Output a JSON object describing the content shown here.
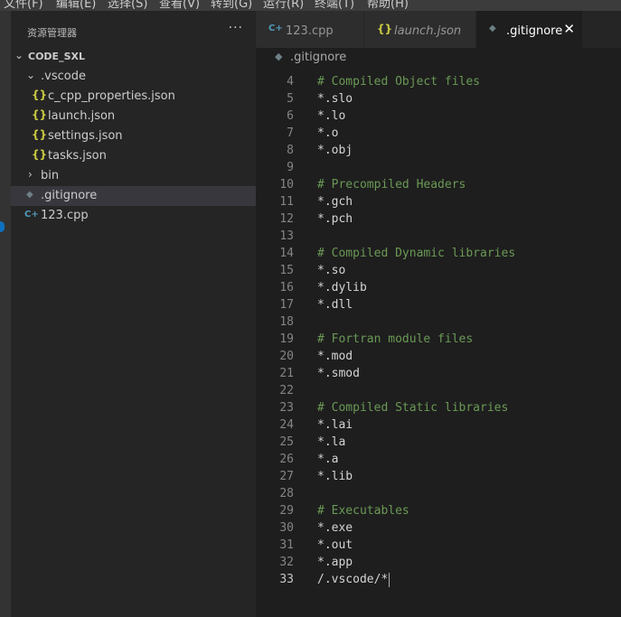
{
  "menu": [
    "文件(F)",
    "编辑(E)",
    "选择(S)",
    "查看(V)",
    "转到(G)",
    "运行(R)",
    "终端(T)",
    "帮助(H)"
  ],
  "sidebar": {
    "title": "资源管理器",
    "more": "···",
    "tree": [
      {
        "label": "CODE_SXL",
        "kind": "folder-root",
        "expanded": true
      },
      {
        "label": ".vscode",
        "kind": "folder",
        "expanded": true
      },
      {
        "label": "c_cpp_properties.json",
        "kind": "json"
      },
      {
        "label": "launch.json",
        "kind": "json"
      },
      {
        "label": "settings.json",
        "kind": "json"
      },
      {
        "label": "tasks.json",
        "kind": "json"
      },
      {
        "label": "bin",
        "kind": "folder",
        "expanded": false
      },
      {
        "label": ".gitignore",
        "kind": "git",
        "selected": true
      },
      {
        "label": "123.cpp",
        "kind": "cpp"
      }
    ]
  },
  "tabs": [
    {
      "label": "123.cpp",
      "icon": "cpp-icon",
      "active": false
    },
    {
      "label": "launch.json",
      "icon": "json-icon",
      "active": false,
      "italic": true
    },
    {
      "label": ".gitignore",
      "icon": "gitignore-icon",
      "active": true
    }
  ],
  "tab_close": "✕",
  "breadcrumb": ".gitignore",
  "icons": {
    "json": "{}",
    "cpp": "C+",
    "git": "◆"
  },
  "colors": {
    "json": "#cbcb41",
    "cpp": "#519aba",
    "git": "#6d8086",
    "comment": "#6a9955",
    "accent": "#0e70c0"
  },
  "editor": {
    "current_line": 33,
    "lines": [
      {
        "n": "4",
        "text": "# Compiled Object files",
        "comment": true
      },
      {
        "n": "5",
        "text": "*.slo"
      },
      {
        "n": "6",
        "text": "*.lo"
      },
      {
        "n": "7",
        "text": "*.o"
      },
      {
        "n": "8",
        "text": "*.obj"
      },
      {
        "n": "9",
        "text": ""
      },
      {
        "n": "10",
        "text": "# Precompiled Headers",
        "comment": true
      },
      {
        "n": "11",
        "text": "*.gch"
      },
      {
        "n": "12",
        "text": "*.pch"
      },
      {
        "n": "13",
        "text": ""
      },
      {
        "n": "14",
        "text": "# Compiled Dynamic libraries",
        "comment": true
      },
      {
        "n": "15",
        "text": "*.so"
      },
      {
        "n": "16",
        "text": "*.dylib"
      },
      {
        "n": "17",
        "text": "*.dll"
      },
      {
        "n": "18",
        "text": ""
      },
      {
        "n": "19",
        "text": "# Fortran module files",
        "comment": true
      },
      {
        "n": "20",
        "text": "*.mod"
      },
      {
        "n": "21",
        "text": "*.smod"
      },
      {
        "n": "22",
        "text": ""
      },
      {
        "n": "23",
        "text": "# Compiled Static libraries",
        "comment": true
      },
      {
        "n": "24",
        "text": "*.lai"
      },
      {
        "n": "25",
        "text": "*.la"
      },
      {
        "n": "26",
        "text": "*.a"
      },
      {
        "n": "27",
        "text": "*.lib"
      },
      {
        "n": "28",
        "text": ""
      },
      {
        "n": "29",
        "text": "# Executables",
        "comment": true
      },
      {
        "n": "30",
        "text": "*.exe"
      },
      {
        "n": "31",
        "text": "*.out"
      },
      {
        "n": "32",
        "text": "*.app"
      },
      {
        "n": "33",
        "text": "/.vscode/*"
      }
    ]
  }
}
